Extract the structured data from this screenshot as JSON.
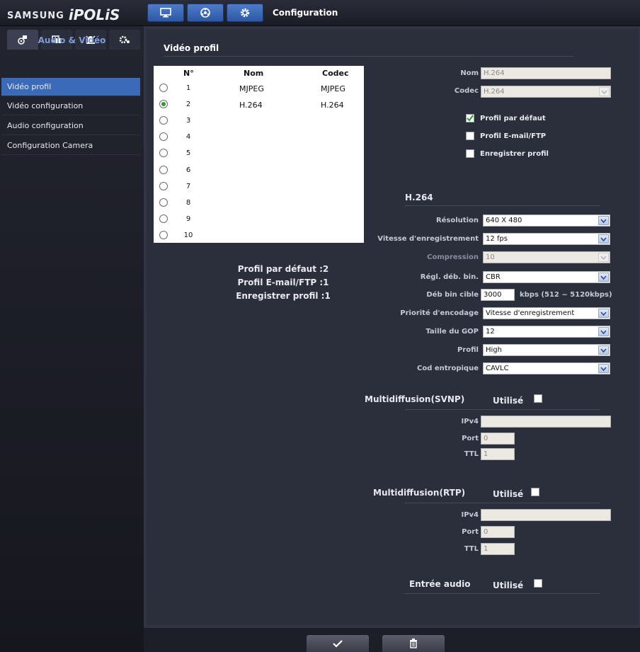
{
  "header": {
    "brand_samsung": "SAMSUNG",
    "brand_ipolis": "iPOLiS",
    "title": "Configuration",
    "buttons": [
      {
        "icon": "monitor-icon"
      },
      {
        "icon": "network-icon"
      },
      {
        "icon": "settings-gear-icon"
      }
    ]
  },
  "sidebar": {
    "tabs": [
      {
        "icon": "camera-settings-icon"
      },
      {
        "icon": "video-stream-icon"
      },
      {
        "icon": "alarm-event-icon"
      },
      {
        "icon": "system-gear-icon"
      }
    ],
    "section_title": "Audio & Vidéo",
    "items": [
      {
        "label": "Vidéo profil",
        "active": true
      },
      {
        "label": "Vidéo configuration",
        "active": false
      },
      {
        "label": "Audio configuration",
        "active": false
      },
      {
        "label": "Configuration Camera",
        "active": false
      }
    ]
  },
  "main": {
    "page_title": "Vidéo profil",
    "profile_table": {
      "headers": [
        "N°",
        "Nom",
        "Codec"
      ],
      "rows": [
        {
          "num": "1",
          "name": "MJPEG",
          "codec": "MJPEG",
          "selected": false
        },
        {
          "num": "2",
          "name": "H.264",
          "codec": "H.264",
          "selected": true
        },
        {
          "num": "3",
          "name": "",
          "codec": "",
          "selected": false
        },
        {
          "num": "4",
          "name": "",
          "codec": "",
          "selected": false
        },
        {
          "num": "5",
          "name": "",
          "codec": "",
          "selected": false
        },
        {
          "num": "6",
          "name": "",
          "codec": "",
          "selected": false
        },
        {
          "num": "7",
          "name": "",
          "codec": "",
          "selected": false
        },
        {
          "num": "8",
          "name": "",
          "codec": "",
          "selected": false
        },
        {
          "num": "9",
          "name": "",
          "codec": "",
          "selected": false
        },
        {
          "num": "10",
          "name": "",
          "codec": "",
          "selected": false
        }
      ]
    },
    "summary": {
      "default_profile": "Profil par défaut :2",
      "email_ftp_profile": "Profil E-mail/FTP :1",
      "record_profile": "Enregistrer profil :1"
    },
    "profile_form": {
      "name_label": "Nom",
      "name_value": "H.264",
      "codec_label": "Codec",
      "codec_value": "H.264",
      "checkboxes": [
        {
          "label": "Profil par défaut",
          "checked": true
        },
        {
          "label": "Profil E-mail/FTP",
          "checked": false
        },
        {
          "label": "Enregistrer profil",
          "checked": false
        }
      ]
    },
    "h264": {
      "section_title": "H.264",
      "resolution_label": "Résolution",
      "resolution_value": "640 X 480",
      "framerate_label": "Vitesse d'enregistrement",
      "framerate_value": "12 fps",
      "compression_label": "Compression",
      "compression_value": "10",
      "bitrate_control_label": "Régl. déb. bin.",
      "bitrate_control_value": "CBR",
      "target_bitrate_label": "Déb bin cible",
      "target_bitrate_value": "3000",
      "target_bitrate_unit": "kbps (512 ~ 5120kbps)",
      "encoding_priority_label": "Priorité d'encodage",
      "encoding_priority_value": "Vitesse d'enregistrement",
      "gop_label": "Taille du GOP",
      "gop_value": "12",
      "profile_label": "Profil",
      "profile_value": "High",
      "entropy_label": "Cod entropique",
      "entropy_value": "CAVLC"
    },
    "multicast_svnp": {
      "title": "Multidiffusion(SVNP)",
      "enable_label": "Utilisé",
      "enabled": false,
      "ipv4_label": "IPv4",
      "ipv4_value": "",
      "port_label": "Port",
      "port_value": "0",
      "ttl_label": "TTL",
      "ttl_value": "1"
    },
    "multicast_rtp": {
      "title": "Multidiffusion(RTP)",
      "enable_label": "Utilisé",
      "enabled": false,
      "ipv4_label": "IPv4",
      "ipv4_value": "",
      "port_label": "Port",
      "port_value": "0",
      "ttl_label": "TTL",
      "ttl_value": "1"
    },
    "audio_in": {
      "title": "Entrée audio",
      "enable_label": "Utilisé",
      "enabled": false
    }
  },
  "footer": {
    "apply_icon": "checkmark-icon",
    "delete_icon": "trash-icon"
  },
  "colors": {
    "accent": "#3b6bb8",
    "section_title": "#7f9ad8",
    "checkbox_checked": "#2c9e2a"
  }
}
